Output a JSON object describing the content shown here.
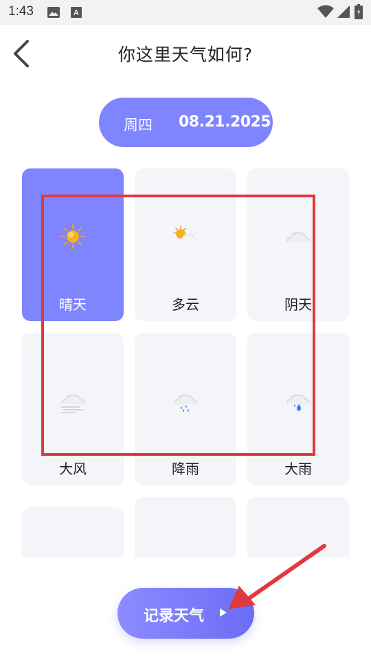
{
  "status_bar": {
    "time": "1:43",
    "icons": [
      "image-icon",
      "font-icon",
      "wifi-icon",
      "signal-icon",
      "battery-icon"
    ]
  },
  "header": {
    "title": "你这里天气如何?",
    "back_icon": "chevron-left-icon"
  },
  "date_pill": {
    "weekday": "周四",
    "date": "08.21.2025",
    "color": "#7f84ff"
  },
  "weather_options": [
    {
      "label": "晴天",
      "icon": "sun-icon",
      "selected": true
    },
    {
      "label": "多云",
      "icon": "partly-cloudy-icon",
      "selected": false
    },
    {
      "label": "阴天",
      "icon": "cloud-icon",
      "selected": false
    },
    {
      "label": "大风",
      "icon": "wind-icon",
      "selected": false
    },
    {
      "label": "降雨",
      "icon": "rain-icon",
      "selected": false
    },
    {
      "label": "大雨",
      "icon": "heavy-rain-icon",
      "selected": false
    },
    {
      "label": "",
      "icon": "",
      "selected": false
    },
    {
      "label": "",
      "icon": "",
      "selected": false
    },
    {
      "label": "",
      "icon": "",
      "selected": false
    }
  ],
  "record_button": {
    "label": "记录天气",
    "icon": "play-icon"
  },
  "colors": {
    "accent": "#7f84ff",
    "card_bg": "#f4f5f9",
    "annotation": "#e0393f"
  }
}
